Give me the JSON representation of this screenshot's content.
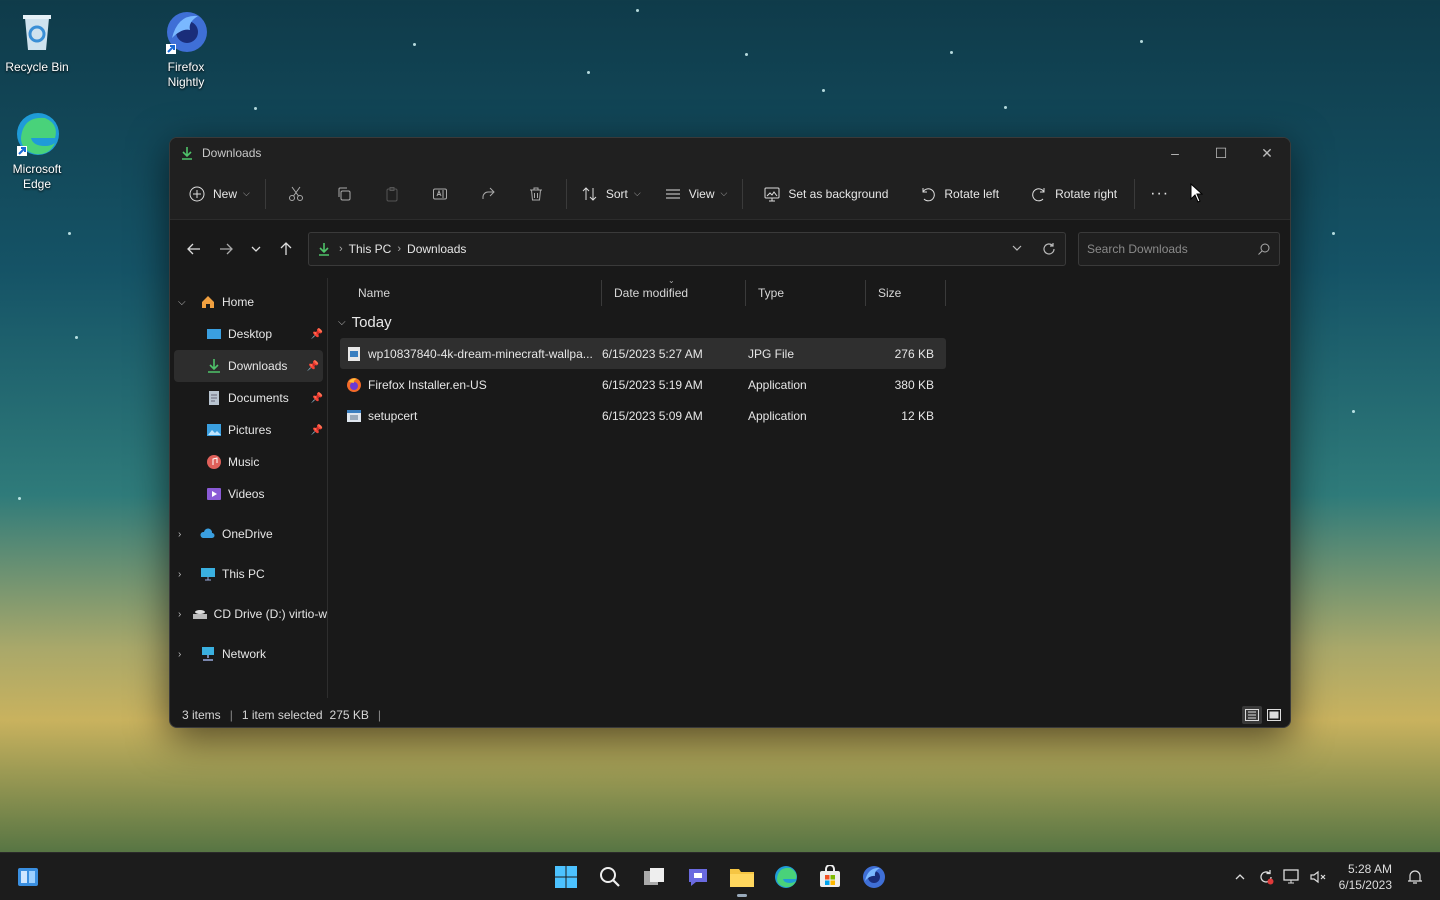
{
  "desktop": {
    "icons": [
      {
        "label": "Recycle Bin",
        "icon": "recycle-bin-icon"
      },
      {
        "label": "Firefox Nightly",
        "icon": "firefox-nightly-icon"
      },
      {
        "label": "Microsoft Edge",
        "icon": "edge-icon"
      }
    ]
  },
  "window": {
    "title": "Downloads",
    "toolbar": {
      "new_label": "New",
      "sort_label": "Sort",
      "view_label": "View",
      "set_background_label": "Set as background",
      "rotate_left_label": "Rotate left",
      "rotate_right_label": "Rotate right",
      "more_label": "···"
    },
    "address": {
      "crumbs": [
        "This PC",
        "Downloads"
      ]
    },
    "search": {
      "placeholder": "Search Downloads"
    },
    "sidebar": {
      "home": "Home",
      "quick": [
        {
          "label": "Desktop",
          "pinned": true
        },
        {
          "label": "Downloads",
          "pinned": true
        },
        {
          "label": "Documents",
          "pinned": true
        },
        {
          "label": "Pictures",
          "pinned": true
        },
        {
          "label": "Music",
          "pinned": false
        },
        {
          "label": "Videos",
          "pinned": false
        }
      ],
      "onedrive": "OneDrive",
      "thispc": "This PC",
      "cddrive": "CD Drive (D:) virtio-w",
      "network": "Network"
    },
    "columns": {
      "name": "Name",
      "date": "Date modified",
      "type": "Type",
      "size": "Size"
    },
    "group": "Today",
    "files": [
      {
        "name": "wp10837840-4k-dream-minecraft-wallpa...",
        "date": "6/15/2023 5:27 AM",
        "type": "JPG File",
        "size": "276 KB",
        "selected": true
      },
      {
        "name": "Firefox Installer.en-US",
        "date": "6/15/2023 5:19 AM",
        "type": "Application",
        "size": "380 KB",
        "selected": false
      },
      {
        "name": "setupcert",
        "date": "6/15/2023 5:09 AM",
        "type": "Application",
        "size": "12 KB",
        "selected": false
      }
    ],
    "status": {
      "items": "3 items",
      "selected": "1 item selected",
      "size": "275 KB"
    }
  },
  "taskbar": {
    "time": "5:28 AM",
    "date": "6/15/2023"
  }
}
